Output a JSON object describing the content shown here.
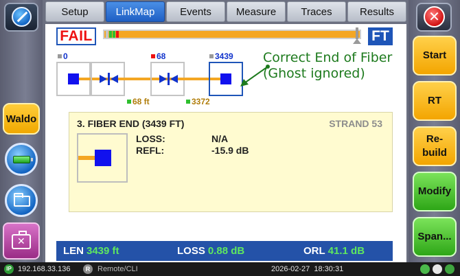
{
  "tabs": [
    {
      "label": "Setup",
      "active": false
    },
    {
      "label": "LinkMap",
      "active": true
    },
    {
      "label": "Events",
      "active": false
    },
    {
      "label": "Measure",
      "active": false
    },
    {
      "label": "Traces",
      "active": false
    },
    {
      "label": "Results",
      "active": false
    }
  ],
  "left_sidebar": {
    "waldo_label": "Waldo",
    "icons": [
      "home-icon",
      "battery-icon",
      "folder-icon",
      "toolbox-icon"
    ]
  },
  "right_sidebar": {
    "close_icon": "close-icon",
    "buttons": [
      {
        "label": "Start",
        "color": "#f3a500"
      },
      {
        "label": "RT",
        "color": "#f3a500"
      },
      {
        "label": "Re-\nbuild",
        "color": "#f3a500"
      },
      {
        "label": "Modify",
        "color": "#2ea617"
      },
      {
        "label": "Span...",
        "color": "#2ea617"
      }
    ]
  },
  "linkmap": {
    "result": "FAIL",
    "unit": "FT",
    "event_positions": [
      "0",
      "68",
      "3439"
    ],
    "distances": [
      "68 ft",
      "3372"
    ],
    "annotation_line1": "Correct End of Fiber",
    "annotation_line2": "(Ghost ignored)"
  },
  "detail": {
    "title": "3. FIBER END (3439 FT)",
    "strand": "STRAND 53",
    "loss_label": "LOSS:",
    "loss_value": "N/A",
    "refl_label": "REFL:",
    "refl_value": "-15.9 dB"
  },
  "summary": {
    "len_label": "LEN",
    "len_value": "3439 ft",
    "loss_label": "LOSS",
    "loss_value": "0.88 dB",
    "orl_label": "ORL",
    "orl_value": "41.1 dB"
  },
  "system_bar": {
    "ip_badge": "IP",
    "ip": "192.168.33.136",
    "remote_badge": "R",
    "remote": "Remote/CLI",
    "datetime": "2026-02-27  18:30:31"
  },
  "colors": {
    "fail": "#ee1111",
    "fiber": "#f4a623",
    "event": "#1111ee",
    "accent": "#1e55b8",
    "annotation": "#1d7a1d",
    "value_green": "#5fe85f"
  }
}
